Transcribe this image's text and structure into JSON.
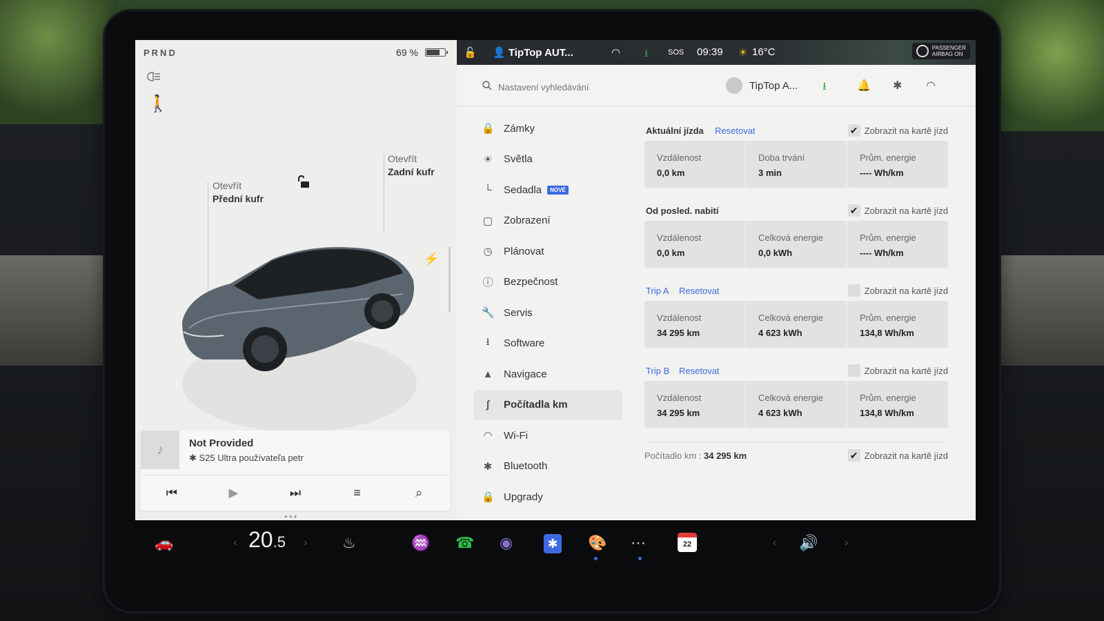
{
  "colors": {
    "accent": "#3e6ae1",
    "alert": "#d33333",
    "download": "#2fa84f",
    "phone": "#2fbf4a"
  },
  "left_panel": {
    "gear": "PRND",
    "battery_pct": "69 %",
    "battery_level": 0.69,
    "frunk_label_1": "Otevřít",
    "frunk_label_2": "Přední kufr",
    "trunk_label_1": "Otevřít",
    "trunk_label_2": "Zadní kufr"
  },
  "media": {
    "title": "Not Provided",
    "source": "S25 Ultra používateľa petr",
    "controls": [
      "prev-icon",
      "play-icon",
      "next-icon",
      "equalizer-icon",
      "search-icon"
    ]
  },
  "status_bar": {
    "profile": "TipTop AUT...",
    "sos": "SOS",
    "time": "09:39",
    "temperature": "16°C",
    "airbag_line1": "PASSENGER",
    "airbag_line2": "AIRBAG ON"
  },
  "settings_header": {
    "search_placeholder": "Nastavení vyhledávání",
    "profile_name": "TipTop A..."
  },
  "menu": {
    "items": [
      {
        "label": "Zámky",
        "icon": "lock-icon"
      },
      {
        "label": "Světla",
        "icon": "light-icon"
      },
      {
        "label": "Sedadla",
        "icon": "seat-icon",
        "badge": "NOVÉ"
      },
      {
        "label": "Zobrazení",
        "icon": "display-icon"
      },
      {
        "label": "Plánovat",
        "icon": "schedule-icon"
      },
      {
        "label": "Bezpečnost",
        "icon": "safety-icon"
      },
      {
        "label": "Servis",
        "icon": "wrench-icon"
      },
      {
        "label": "Software",
        "icon": "download-icon"
      },
      {
        "label": "Navigace",
        "icon": "navigation-icon"
      },
      {
        "label": "Počítadla km",
        "icon": "trips-icon",
        "active": true
      },
      {
        "label": "Wi-Fi",
        "icon": "wifi-icon"
      },
      {
        "label": "Bluetooth",
        "icon": "bluetooth-icon"
      },
      {
        "label": "Upgrady",
        "icon": "upgrade-icon"
      }
    ]
  },
  "trips": {
    "show_label": "Zobrazit na kartě jízd",
    "reset_label": "Resetovat",
    "current": {
      "title": "Aktuální jízda",
      "checked": true,
      "stats": [
        {
          "k": "Vzdálenost",
          "v": "0,0 km"
        },
        {
          "k": "Doba trvání",
          "v": "3 min"
        },
        {
          "k": "Prům. energie",
          "v": "---- Wh/km"
        }
      ]
    },
    "since_charge": {
      "title": "Od posled. nabití",
      "checked": true,
      "stats": [
        {
          "k": "Vzdálenost",
          "v": "0,0 km"
        },
        {
          "k": "Celková energie",
          "v": "0,0 kWh"
        },
        {
          "k": "Prům. energie",
          "v": "---- Wh/km"
        }
      ]
    },
    "trip_a": {
      "title": "Trip A",
      "checked": false,
      "stats": [
        {
          "k": "Vzdálenost",
          "v": "34 295 km"
        },
        {
          "k": "Celková energie",
          "v": "4 623 kWh"
        },
        {
          "k": "Prům. energie",
          "v": "134,8 Wh/km"
        }
      ]
    },
    "trip_b": {
      "title": "Trip B",
      "checked": false,
      "stats": [
        {
          "k": "Vzdálenost",
          "v": "34 295 km"
        },
        {
          "k": "Celková energie",
          "v": "4 623 kWh"
        },
        {
          "k": "Prům. energie",
          "v": "134,8 Wh/km"
        }
      ]
    },
    "odometer_label": "Počítadlo km :",
    "odometer_value": "34 295 km",
    "odometer_checked": true
  },
  "taskbar": {
    "temp_main": "20",
    "temp_decimal": ".5",
    "calendar_day": "22"
  }
}
